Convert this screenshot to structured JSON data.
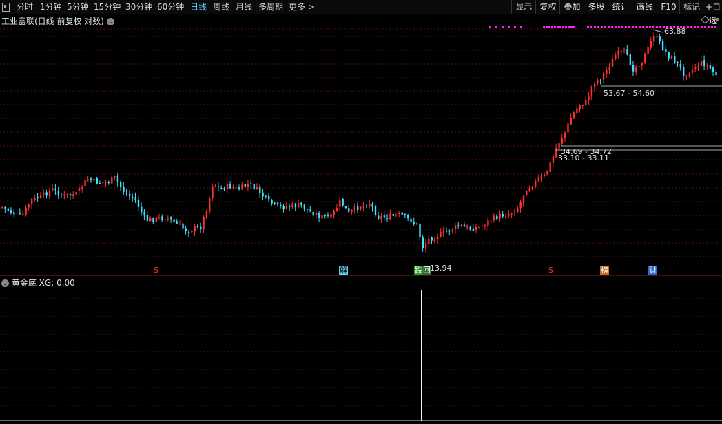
{
  "toolbar": {
    "periods": [
      "分时",
      "1分钟",
      "5分钟",
      "15分钟",
      "30分钟",
      "60分钟",
      "日线",
      "周线",
      "月线",
      "多周期",
      "更多 >"
    ],
    "active_period": "日线",
    "buttons": [
      "显示",
      "复权",
      "叠加",
      "多股",
      "统计",
      "画线",
      "F10",
      "标记",
      "+自选"
    ]
  },
  "main_chart": {
    "title": "工业富联(日线 前复权 对数)",
    "high_label": "63.88",
    "low_label": "13.94",
    "range_labels": [
      "53.67 - 54.60",
      "34.69 - 34.72",
      "33.10 - 33.11"
    ],
    "markers": [
      {
        "text": "S",
        "color": "#ff3030",
        "bg": "",
        "name": "s-marker-1"
      },
      {
        "text": "解",
        "color": "#000",
        "bg": "#5fc8e8",
        "name": "unlock-marker"
      },
      {
        "text": "跌",
        "color": "#fff",
        "bg": "#2a9a2a",
        "name": "drop-marker"
      },
      {
        "text": "回",
        "color": "#fff",
        "bg": "#2a6a2a",
        "name": "return-marker"
      },
      {
        "text": "S",
        "color": "#ff3030",
        "bg": "",
        "name": "s-marker-2"
      },
      {
        "text": "榜",
        "color": "#fff",
        "bg": "#c86a20",
        "name": "list-marker"
      },
      {
        "text": "财",
        "color": "#fff",
        "bg": "#2a6ad0",
        "name": "finance-marker"
      }
    ],
    "colors": {
      "up": "#ff3030",
      "down": "#40e0ff",
      "grid": "#5a1010",
      "signal": "#ff20ff"
    }
  },
  "indicator": {
    "name": "黄金底",
    "label": "XG:",
    "value": "0.00"
  }
}
